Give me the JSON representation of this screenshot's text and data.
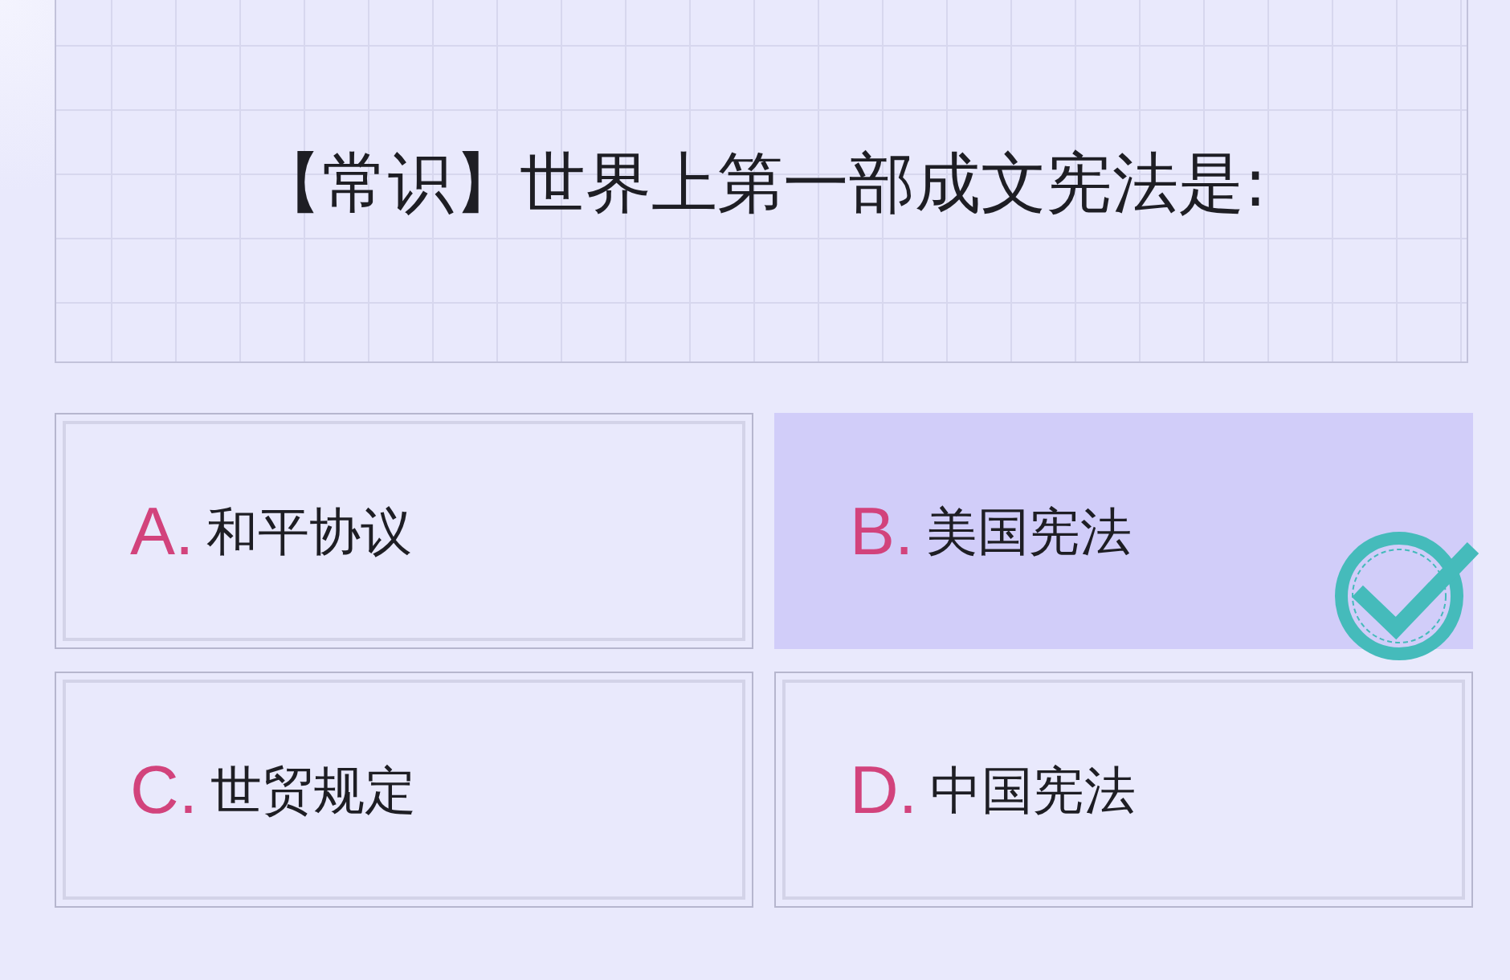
{
  "question": {
    "text": "【常识】世界上第一部成文宪法是:"
  },
  "options": [
    {
      "letter": "A.",
      "text": "和平协议",
      "selected": false,
      "correct": false
    },
    {
      "letter": "B.",
      "text": "美国宪法",
      "selected": true,
      "correct": true
    },
    {
      "letter": "C.",
      "text": "世贸规定",
      "selected": false,
      "correct": false
    },
    {
      "letter": "D.",
      "text": "中国宪法",
      "selected": false,
      "correct": false
    }
  ]
}
